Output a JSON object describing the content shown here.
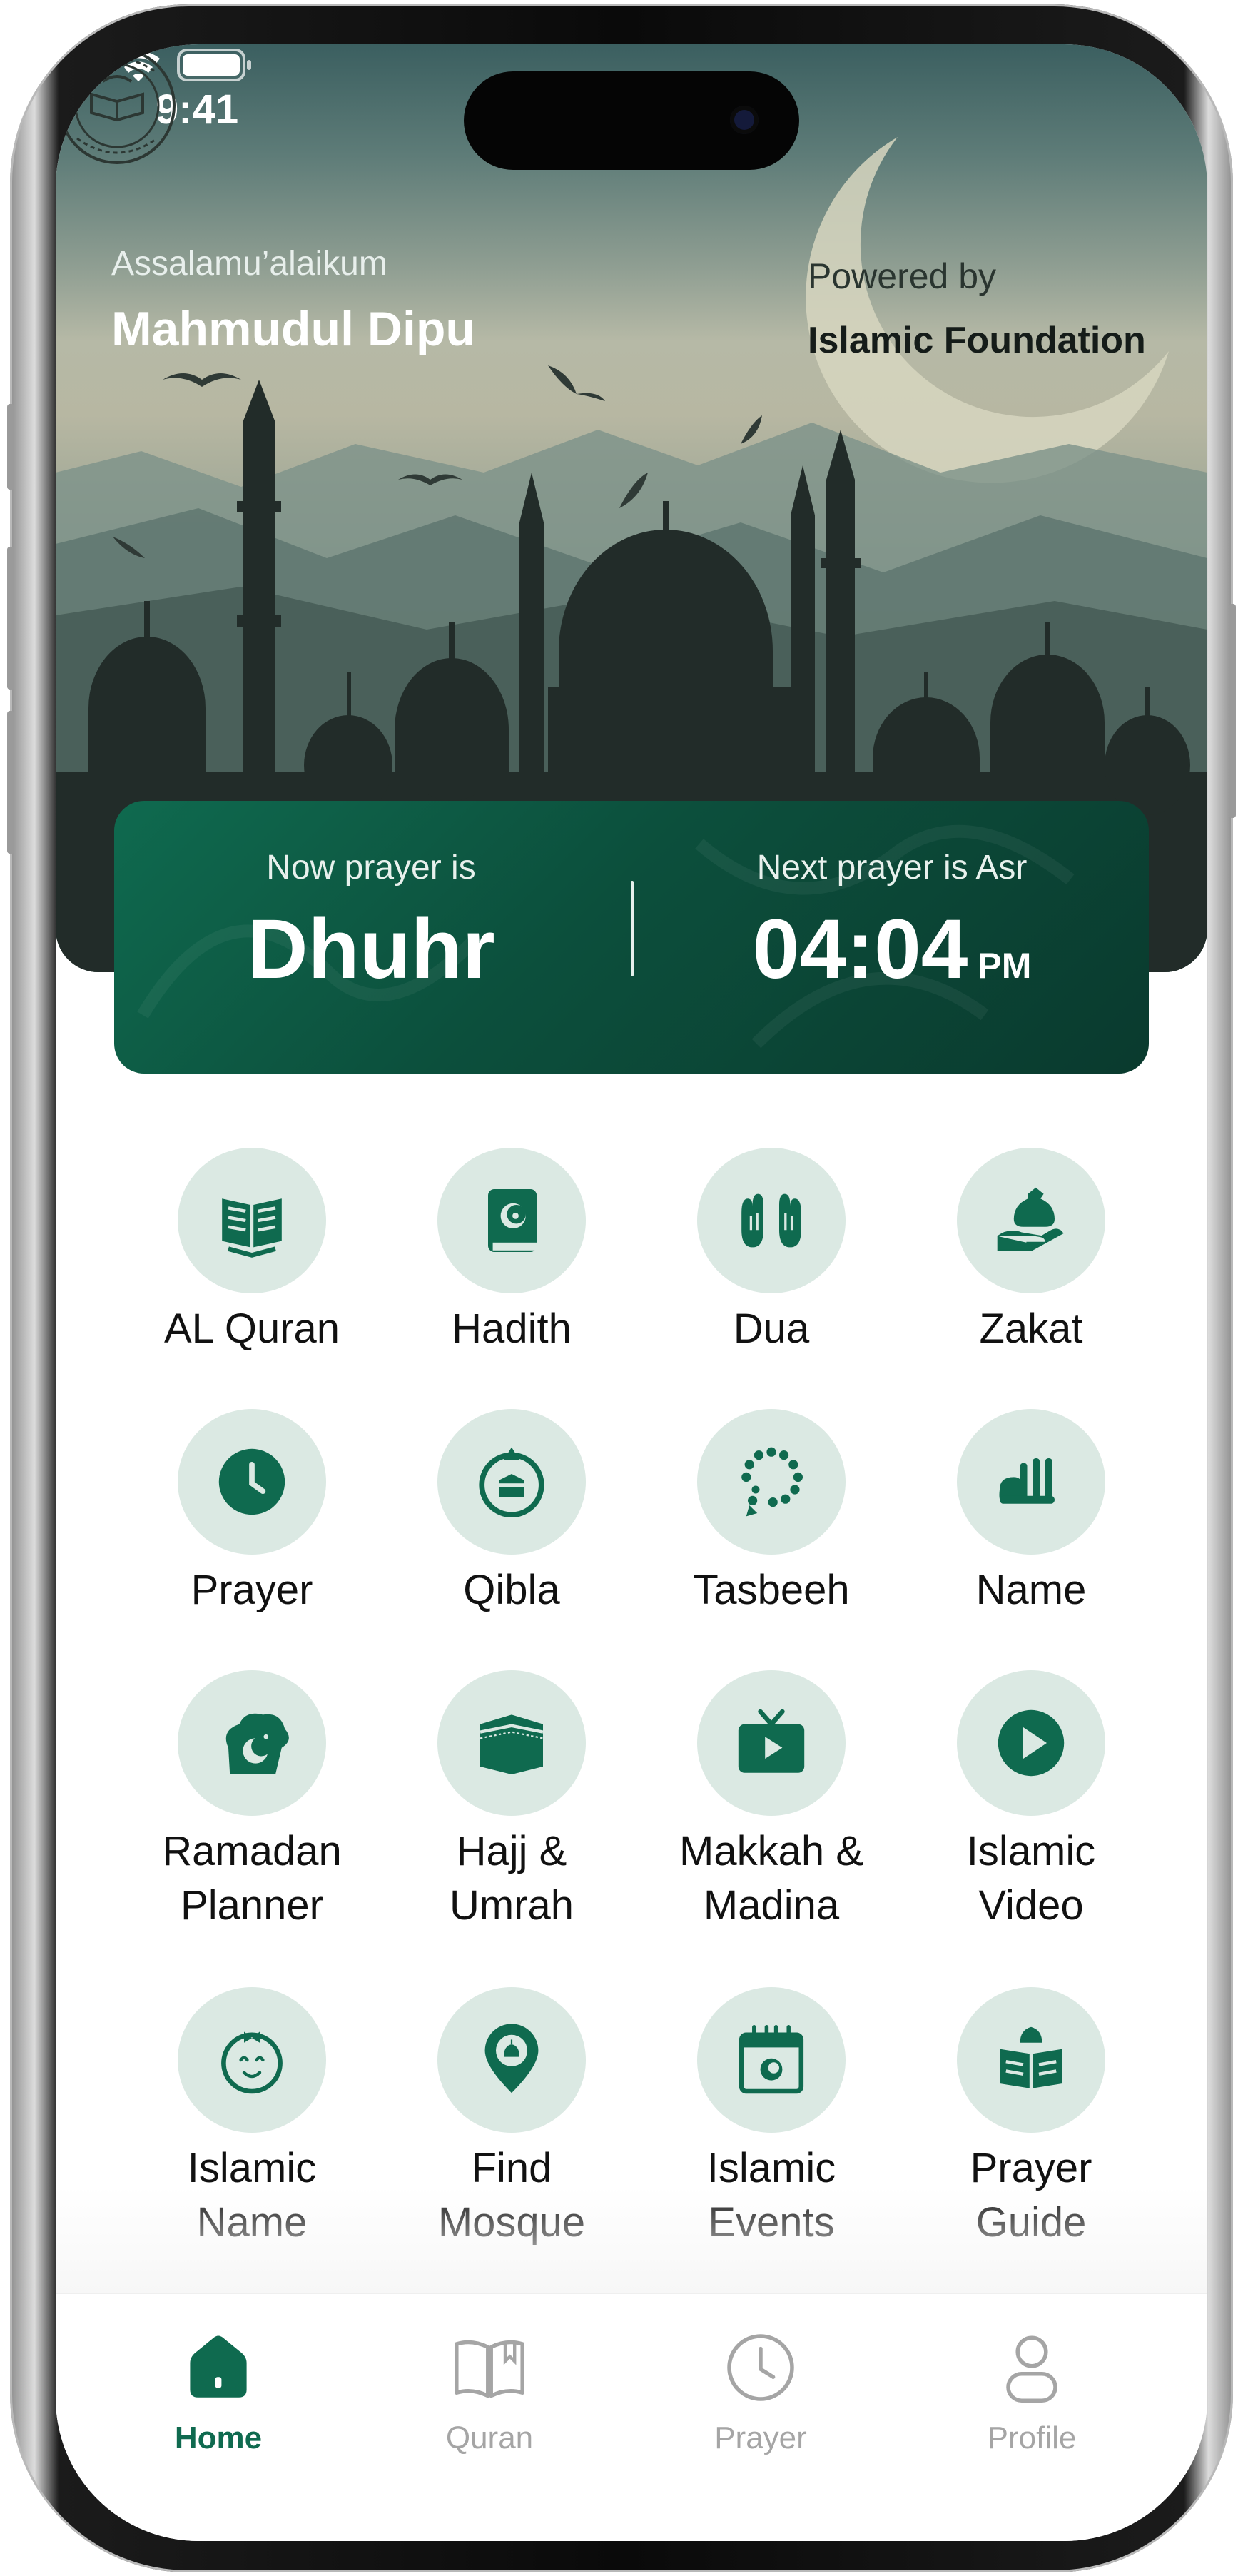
{
  "status": {
    "time": "9:41"
  },
  "header": {
    "greeting": "Assalamu’alaikum",
    "user_name": "Mahmudul Dipu",
    "powered_by": "Powered by",
    "organization": "Islamic Foundation"
  },
  "prayer": {
    "now_label": "Now prayer is",
    "now_name": "Dhuhr",
    "next_label": "Next prayer is Asr",
    "next_time": "04:04",
    "next_ampm": "PM"
  },
  "grid": [
    {
      "label": "AL Quran",
      "icon": "quran-book-icon"
    },
    {
      "label": "Hadith",
      "icon": "hadith-book-icon"
    },
    {
      "label": "Dua",
      "icon": "praying-hands-icon"
    },
    {
      "label": "Zakat",
      "icon": "zakat-giving-hand-icon"
    },
    {
      "label": "Prayer",
      "icon": "clock-icon"
    },
    {
      "label": "Qibla",
      "icon": "qibla-compass-icon"
    },
    {
      "label": "Tasbeeh",
      "icon": "tasbeeh-beads-icon"
    },
    {
      "label": "Name",
      "icon": "allah-calligraphy-icon"
    },
    {
      "label": "Ramadan\nPlanner",
      "icon": "ramadan-crescent-icon"
    },
    {
      "label": "Hajj &\nUmrah",
      "icon": "kaaba-icon"
    },
    {
      "label": "Makkah &\nMadina",
      "icon": "tv-play-icon"
    },
    {
      "label": "Islamic\nVideo",
      "icon": "play-circle-icon"
    },
    {
      "label": "Islamic\nName",
      "icon": "baby-face-icon"
    },
    {
      "label": "Find\nMosque",
      "icon": "mosque-location-pin-icon"
    },
    {
      "label": "Islamic\nEvents",
      "icon": "calendar-icon"
    },
    {
      "label": "Prayer\nGuide",
      "icon": "open-book-mosque-icon"
    }
  ],
  "tabs": [
    {
      "label": "Home",
      "icon": "home-icon",
      "active": true
    },
    {
      "label": "Quran",
      "icon": "book-icon",
      "active": false
    },
    {
      "label": "Prayer",
      "icon": "clock-icon",
      "active": false
    },
    {
      "label": "Profile",
      "icon": "user-icon",
      "active": false
    }
  ],
  "colors": {
    "accent": "#0f6a4f",
    "icon_bg": "#dbe9e3",
    "tab_inactive": "#a5a5a5"
  }
}
